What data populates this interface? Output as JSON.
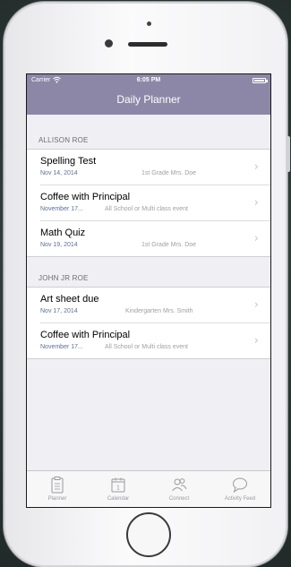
{
  "status_bar": {
    "carrier": "Carrier",
    "time": "6:05 PM"
  },
  "nav": {
    "title": "Daily Planner"
  },
  "sections": [
    {
      "header": "ALLISON ROE",
      "items": [
        {
          "title": "Spelling Test",
          "date": "Nov 14, 2014",
          "detail": "1st Grade Mrs. Doe"
        },
        {
          "title": "Coffee with Principal",
          "date": "November 17...",
          "detail": "All School or Multi class event"
        },
        {
          "title": "Math Quiz",
          "date": "Nov 19, 2014",
          "detail": "1st Grade Mrs. Doe"
        }
      ]
    },
    {
      "header": "JOHN JR ROE",
      "items": [
        {
          "title": "Art sheet due",
          "date": "Nov 17, 2014",
          "detail": "Kindergarten Mrs. Smith"
        },
        {
          "title": "Coffee with Principal",
          "date": "November 17...",
          "detail": "All School or Multi class event"
        }
      ]
    }
  ],
  "tabs": [
    {
      "label": "Planner",
      "icon": "clipboard-icon"
    },
    {
      "label": "Calendar",
      "icon": "calendar-icon",
      "day": "1"
    },
    {
      "label": "Connect",
      "icon": "people-icon"
    },
    {
      "label": "Activity Feed",
      "icon": "speech-bubble-icon"
    }
  ],
  "colors": {
    "nav_bar": "#8c87a6",
    "date_text": "#5c6f9d",
    "background": "#efeff4"
  }
}
